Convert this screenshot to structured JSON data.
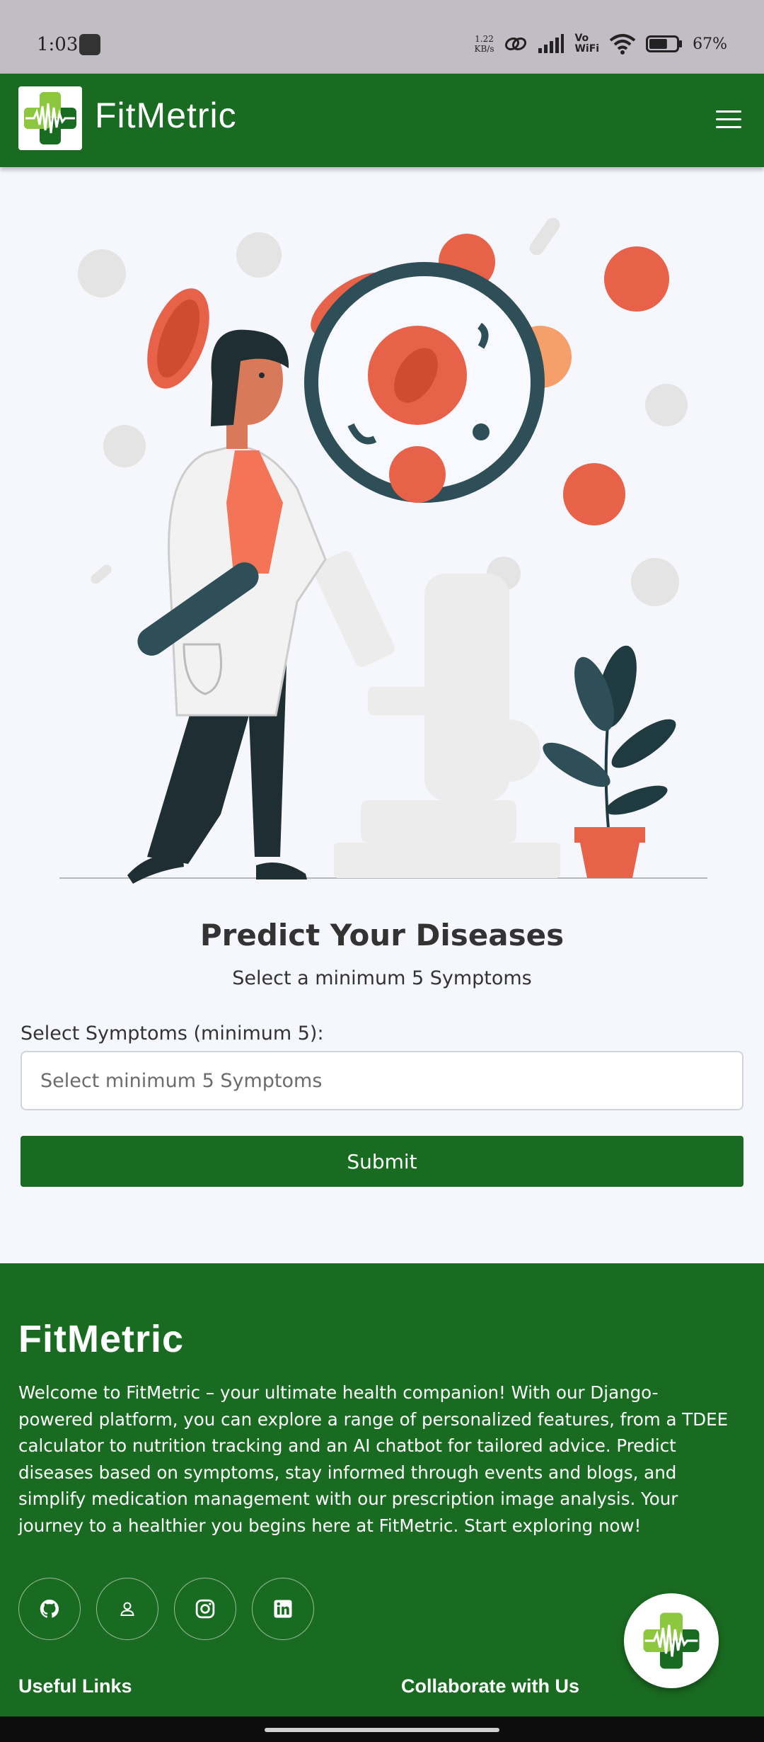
{
  "status_bar": {
    "time": "1:03",
    "speed_value": "1.22",
    "speed_unit": "KB/s",
    "volte_top": "Vo",
    "volte_bottom": "WiFi",
    "battery": "67%",
    "battery_level": 0.67
  },
  "header": {
    "brand": "FitMetric",
    "menu_icon": "hamburger-menu-icon"
  },
  "hero": {
    "illustration": "doctor-magnifier-virus-illustration"
  },
  "predict": {
    "title": "Predict Your Diseases",
    "subtitle": "Select a minimum 5 Symptoms",
    "field_label": "Select Symptoms (minimum 5):",
    "placeholder": "Select minimum 5 Symptoms",
    "submit_label": "Submit"
  },
  "footer": {
    "brand": "FitMetric",
    "description": "Welcome to FitMetric – your ultimate health companion! With our Django-powered platform, you can explore a range of personalized features, from a TDEE calculator to nutrition tracking and an AI chatbot for tailored advice. Predict diseases based on symptoms, stay informed through events and blogs, and simplify medication management with our prescription image analysis. Your journey to a healthier you begins here at FitMetric. Start exploring now!",
    "social_icons": [
      "github-icon",
      "user-icon",
      "instagram-icon",
      "linkedin-icon"
    ],
    "col_useful_links": "Useful Links",
    "col_collaborate": "Collaborate with Us"
  },
  "colors": {
    "brand_green": "#1a6b22",
    "accent_red": "#e8624a",
    "background": "#f5f7fd"
  }
}
